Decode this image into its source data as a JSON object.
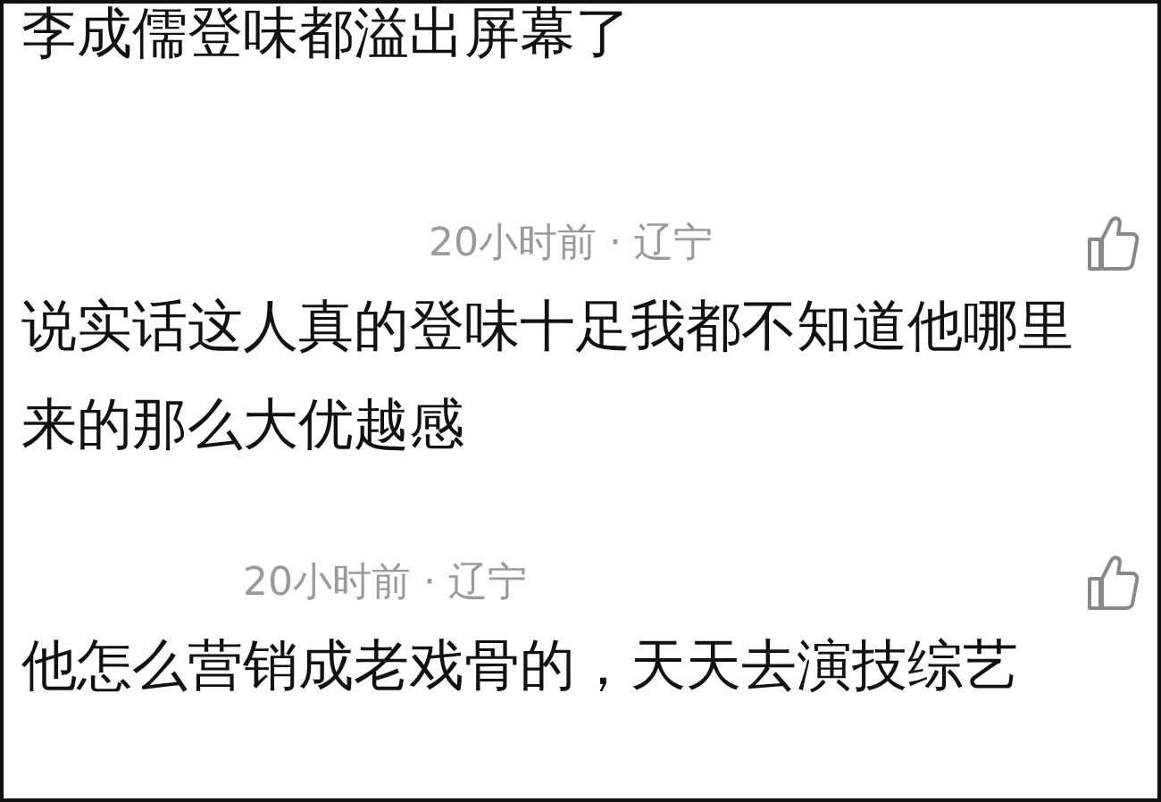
{
  "top_text": "李成儒登味都溢出屏幕了",
  "comments": [
    {
      "time": "20小时前",
      "separator": "·",
      "location": "辽宁",
      "text": "说实话这人真的登味十足我都不知道他哪里来的那么大优越感"
    },
    {
      "time": "20小时前",
      "separator": "·",
      "location": "辽宁",
      "text": "他怎么营销成老戏骨的，天天去演技综艺"
    }
  ]
}
